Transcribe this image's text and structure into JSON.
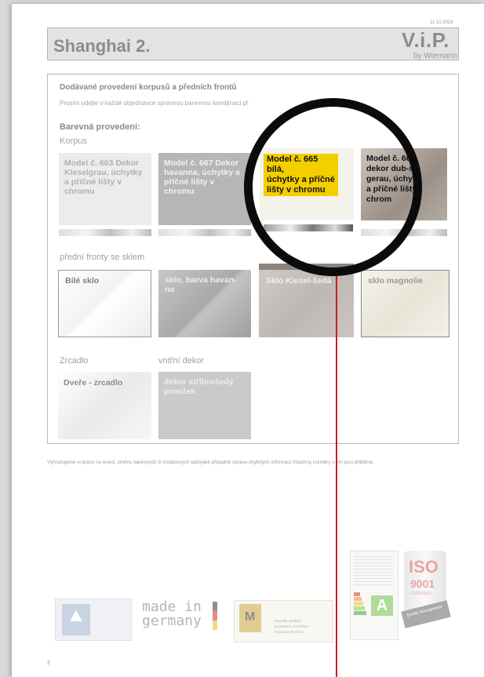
{
  "doc": {
    "date": "11.10.2019",
    "title": "Shanghai 2.",
    "brand": "V.i.P.",
    "brand_sub": "by Wiemann",
    "section_title": "Dodávané provedení korpusů a předních frontů",
    "section_note": "Prosím udejte v každé objednávce správnou barevnou kombinaci př",
    "section_note_tail": "usů!",
    "colors_heading": "Barevná provedení:",
    "korpus_label": "Korpus",
    "korpus": [
      {
        "label": "Model č. 663 Dekor Kieselgrau, úchytky a příčné lišty v chromu"
      },
      {
        "label": "Model č. 667 Dekor havanna, úchytky a příčné lišty v chromu"
      },
      {
        "label": "Model č. 665 bílá, úchytky a příčné lišty v chromu",
        "l1": "Model č. 665",
        "l2": "bílá,",
        "l3": "úchytky a příčné",
        "l4": "lišty v chromu"
      },
      {
        "label": "Model č. 66 dekor dub-s gerau, úchyt a příčné lišty chrom",
        "l1": "Model č. 66",
        "l2": "dekor dub-s",
        "l3": "gerau, úchyt",
        "l4": "a příčné lišty",
        "l5": "chrom"
      }
    ],
    "fronts_label": "přední fronty se sklem",
    "fronts": [
      {
        "label": "Bílé sklo"
      },
      {
        "label": "sklo, barva havan- na"
      },
      {
        "label": "Sklo Kiesel-šedá"
      },
      {
        "label": "sklo magnolie"
      }
    ],
    "mirror_label": "Zrcadlo",
    "mirror": {
      "label": "Dveře - zrcadlo"
    },
    "inner_label": "vntřní dekor",
    "inner": {
      "label": "dekor stříbrošedý proužek"
    },
    "footer": "Vyhrazujeme si právo na event. změnu barevných či modelových odchylek případně opravu chybných informací.Všechny rozměry v cm jsou přibližné.",
    "page_number": "2"
  },
  "logos": {
    "made_in": "made in",
    "germany": "germany",
    "qual_lines": [
      "Geprüfte Qualität",
      "Garantierte Sicherheit",
      "Gesunder Wohnen"
    ],
    "energy_class": "A",
    "iso_top": "ISO",
    "iso_num": "9001",
    "iso_cert": "CERTIFIED",
    "iso_band": "Quality Management"
  },
  "colors": {
    "highlight": "#f4cf00",
    "lens": "#0b0b0b",
    "pointer": "#c8201b"
  }
}
